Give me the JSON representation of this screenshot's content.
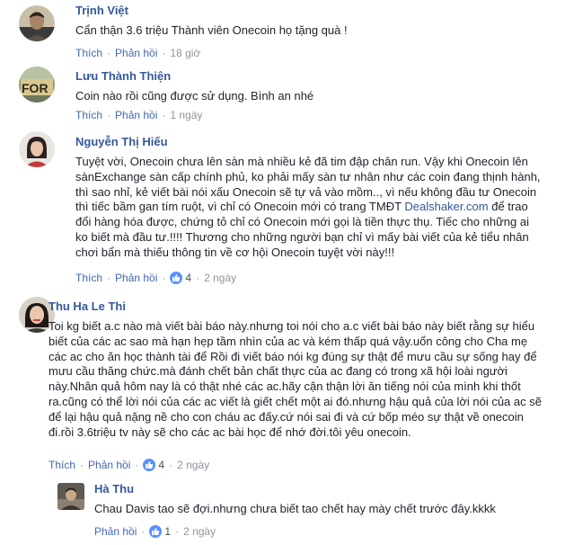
{
  "comments": [
    {
      "name": "Trịnh Việt",
      "text": "Cẩn thận 3.6 triệu Thành viên Onecoin họ tặng quà !",
      "like": "Thích",
      "reply": "Phản hồi",
      "time": "18 giờ"
    },
    {
      "name": "Lưu Thành Thiện",
      "text": "Coin nào rồi cũng được sử dụng. Bình an nhé",
      "like": "Thích",
      "reply": "Phản hồi",
      "time": "1 ngày"
    },
    {
      "name": "Nguyễn Thị Hiếu",
      "text_before_link": "Tuyệt vời, Onecoin chưa lên sàn mà nhiều kẻ đã tim đập chân run. Vậy khi Onecoin lên sànExchange sàn cấp chính phủ, ko phải mấy sàn tư nhân như các coin đang thịnh hành, thì sao nhỉ, kẻ viết bài nói xấu Onecoin sẽ tự vả vào mồm.., vì nếu không đầu tư Onecoin thì tiếc bầm gan tím ruột, vì chỉ có Onecoin mới có trang TMĐT ",
      "link": "Dealshaker.com",
      "text_after_link": " để trao đổi hàng hóa được, chứng tỏ chỉ có Onecoin mới gọi là tiền thực thụ. Tiếc cho những ai ko biết mà đầu tư.!!!! Thương cho những người bạn chỉ vì mấy bài viết của kẻ tiểu nhân chơi bẩn mà thiếu thông tin về cơ hội Onecoin tuyệt vời này!!!",
      "like": "Thích",
      "reply": "Phản hồi",
      "likes": "4",
      "time": "2 ngày"
    },
    {
      "name": "Thu Ha Le Thi",
      "text": "Toi kg biết a.c nào mà viết bài báo này.nhưng toi nói cho a.c viết bài báo này biết rằng sự hiểu biết của các ac sao mà hạn hẹp tầm nhìn của ac và kém thấp quá vậy.uổn công cho Cha mẹ các ac cho ăn học thành tài để Rồi đi viết báo nói kg đúng sự thật để mưu cầu sự sống hay để mưu cầu thăng chức.mà đánh chết bản chất thực của ac đang có trong xã hội loài người này.Nhân quả hôm nay là có thật nhé các ac.hãy cận thận lời ăn tiếng nói của mình khi thốt ra.cũng có thể lời nói của các ac viết là giết chết một ai đó.nhưng hậu quả của lời nói của ac sẽ để lại hậu quả nặng nề cho con cháu ac đấy.cứ nói sai đi và cứ bốp méo sự thật về onecoin đi.rồi 3.6triệu tv này sẽ cho các ac bài học để nhớ đời.tôi yêu onecoin.",
      "like": "Thích",
      "reply": "Phản hồi",
      "likes": "4",
      "time": "2 ngày"
    },
    {
      "name": "Hà Thu",
      "text": "Chau Davis tao sẽ đợi.nhưng chưa biết tao chết hay mày chết trước đây.kkkk",
      "reply": "Phản hồi",
      "likes": "1",
      "time": "2 ngày"
    }
  ],
  "colors": {
    "name": "#365899",
    "action": "#4267b2",
    "meta": "#90949c",
    "like_badge": "#5890ff"
  }
}
